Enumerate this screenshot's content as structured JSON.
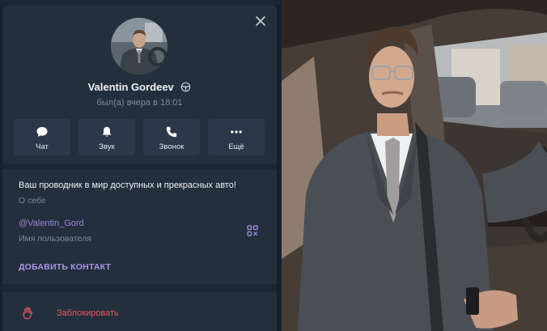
{
  "profile": {
    "name": "Valentin Gordeev",
    "status": "был(а) вчера в 18:01"
  },
  "actions": [
    {
      "label": "Чат",
      "icon": "chat-bubble-icon"
    },
    {
      "label": "Звук",
      "icon": "bell-icon"
    },
    {
      "label": "Звонок",
      "icon": "phone-icon"
    },
    {
      "label": "Ещё",
      "icon": "more-dots-icon"
    }
  ],
  "info": {
    "bio": "Ваш проводник в мир доступных и прекрасных авто!",
    "bio_caption": "О себе",
    "username": "@Valentin_Gord",
    "username_caption": "Имя пользователя",
    "add_contact": "ДОБАВИТЬ КОНТАКТ"
  },
  "block": {
    "label": "Заблокировать",
    "icon": "hand-stop-icon"
  },
  "colors": {
    "panel": "#242f3d",
    "button": "#2c3847",
    "accent": "#a894e6",
    "danger": "#e4595b",
    "muted": "#7c8b99"
  }
}
